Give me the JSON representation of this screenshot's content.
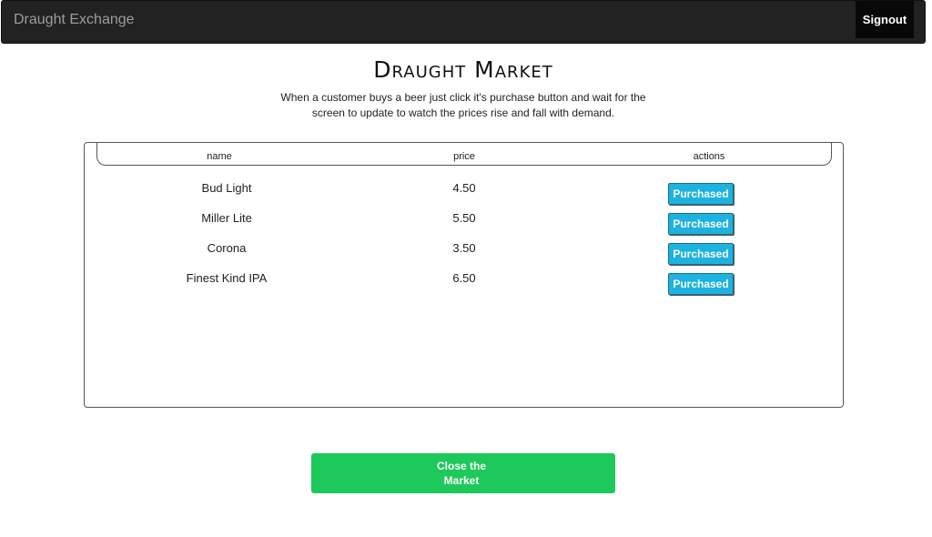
{
  "navbar": {
    "brand": "Draught Exchange",
    "signout_label": "Signout"
  },
  "page": {
    "title": "Draught Market",
    "subtitle_line1": "When a customer buys a beer just click it's purchase button and wait for the",
    "subtitle_line2": "screen to update to watch the prices rise and fall with demand."
  },
  "table": {
    "columns": [
      "name",
      "price",
      "actions"
    ],
    "rows": [
      {
        "name": "Bud Light",
        "price": "4.50",
        "action_label": "Purchased"
      },
      {
        "name": "Miller Lite",
        "price": "5.50",
        "action_label": "Purchased"
      },
      {
        "name": "Corona",
        "price": "3.50",
        "action_label": "Purchased"
      },
      {
        "name": "Finest Kind IPA",
        "price": "6.50",
        "action_label": "Purchased"
      }
    ]
  },
  "close_market": {
    "line1": "Close the",
    "line2": "Market"
  },
  "colors": {
    "navbar_bg": "#222222",
    "purchase_button": "#1db2df",
    "close_button": "#1dc95a"
  }
}
